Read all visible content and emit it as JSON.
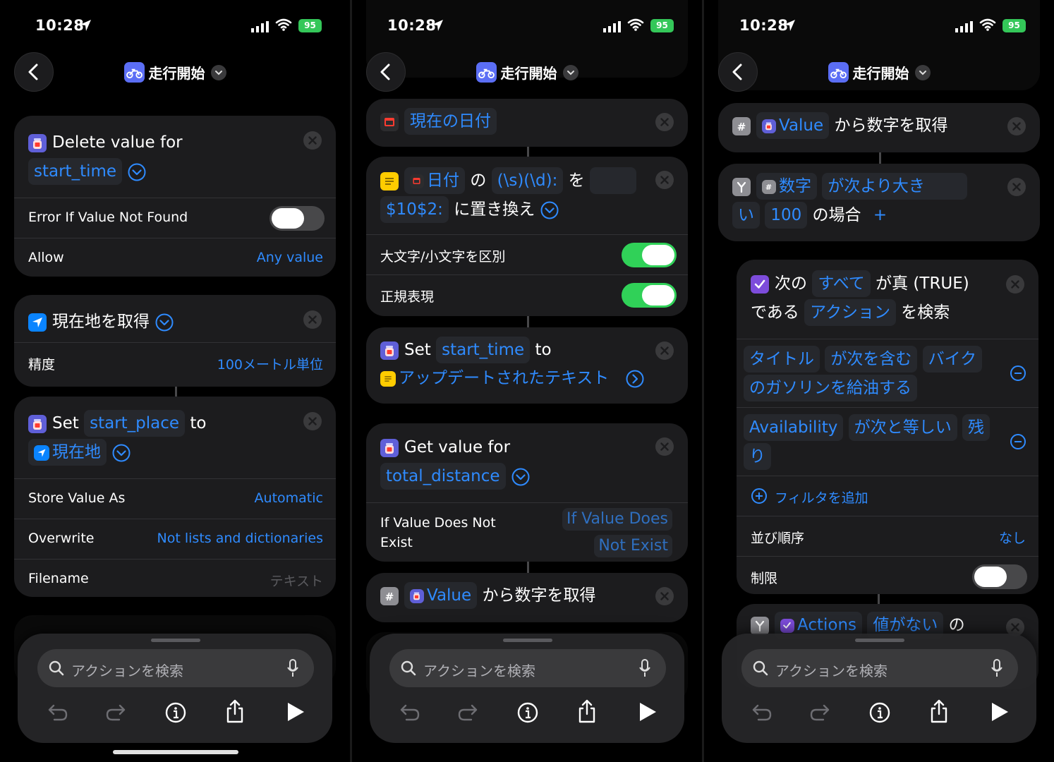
{
  "status": {
    "time": "10:28",
    "battery": "95"
  },
  "nav": {
    "title": "走行開始"
  },
  "search": {
    "placeholder": "アクションを検索"
  },
  "panel1": {
    "card1": {
      "title": "Delete value for",
      "key": "start_time",
      "rows": [
        {
          "label": "Error If Value Not Found"
        },
        {
          "label": "Allow",
          "value": "Any value"
        }
      ]
    },
    "card2": {
      "title": "現在地を取得",
      "row_label": "精度",
      "row_value": "100メートル単位"
    },
    "card3": {
      "set": "Set",
      "key": "start_place",
      "to": "to",
      "value": "現在地",
      "rows": [
        {
          "label": "Store Value As",
          "value": "Automatic"
        },
        {
          "label": "Overwrite",
          "value": "Not lists and dictionaries"
        },
        {
          "label": "Filename",
          "value": "テキスト"
        }
      ]
    }
  },
  "panel2": {
    "card_date": {
      "label": "現在の日付"
    },
    "card_replace": {
      "date": "日付",
      "no": "の",
      "pattern": "(\\s)(\\d):",
      "wo": "を",
      "replacement": "$10$2:",
      "replace_with": "に置き換え",
      "rows": [
        {
          "label": "大文字/小文字を区別"
        },
        {
          "label": "正規表現"
        }
      ]
    },
    "card_set": {
      "set": "Set",
      "key": "start_time",
      "to": "to",
      "value": "アップデートされたテキスト"
    },
    "card_get": {
      "title": "Get value for",
      "key": "total_distance",
      "row_label_1": "If Value Does Not",
      "row_label_2": "Exist",
      "row_value_1": "If Value Does",
      "row_value_2": "Not Exist"
    },
    "card_num": {
      "value": "Value",
      "text": "から数字を取得"
    }
  },
  "panel3": {
    "card_num": {
      "value": "Value",
      "text": "から数字を取得"
    },
    "card_if": {
      "var": "数字",
      "cond1": "が次より大き",
      "cond2": "い",
      "num": "100",
      "case": "の場合",
      "plus": "+"
    },
    "card_find": {
      "next": "次の",
      "all": "すべて",
      "true": "が真 (TRUE)",
      "is": "である",
      "actions": "アクション",
      "search": "を検索",
      "filter1": {
        "a": "タイトル",
        "b": "が次を含む",
        "c": "バイク",
        "d": "のガソリンを給油する"
      },
      "filter2": {
        "a": "Availability",
        "b": "が次と等しい",
        "c": "残",
        "d": "り"
      },
      "add_filter": "フィルタを追加",
      "sort_label": "並び順序",
      "sort_value": "なし",
      "limit_label": "制限"
    },
    "card_next": {
      "a": "Actions",
      "b": "値がない",
      "c": "の"
    }
  }
}
